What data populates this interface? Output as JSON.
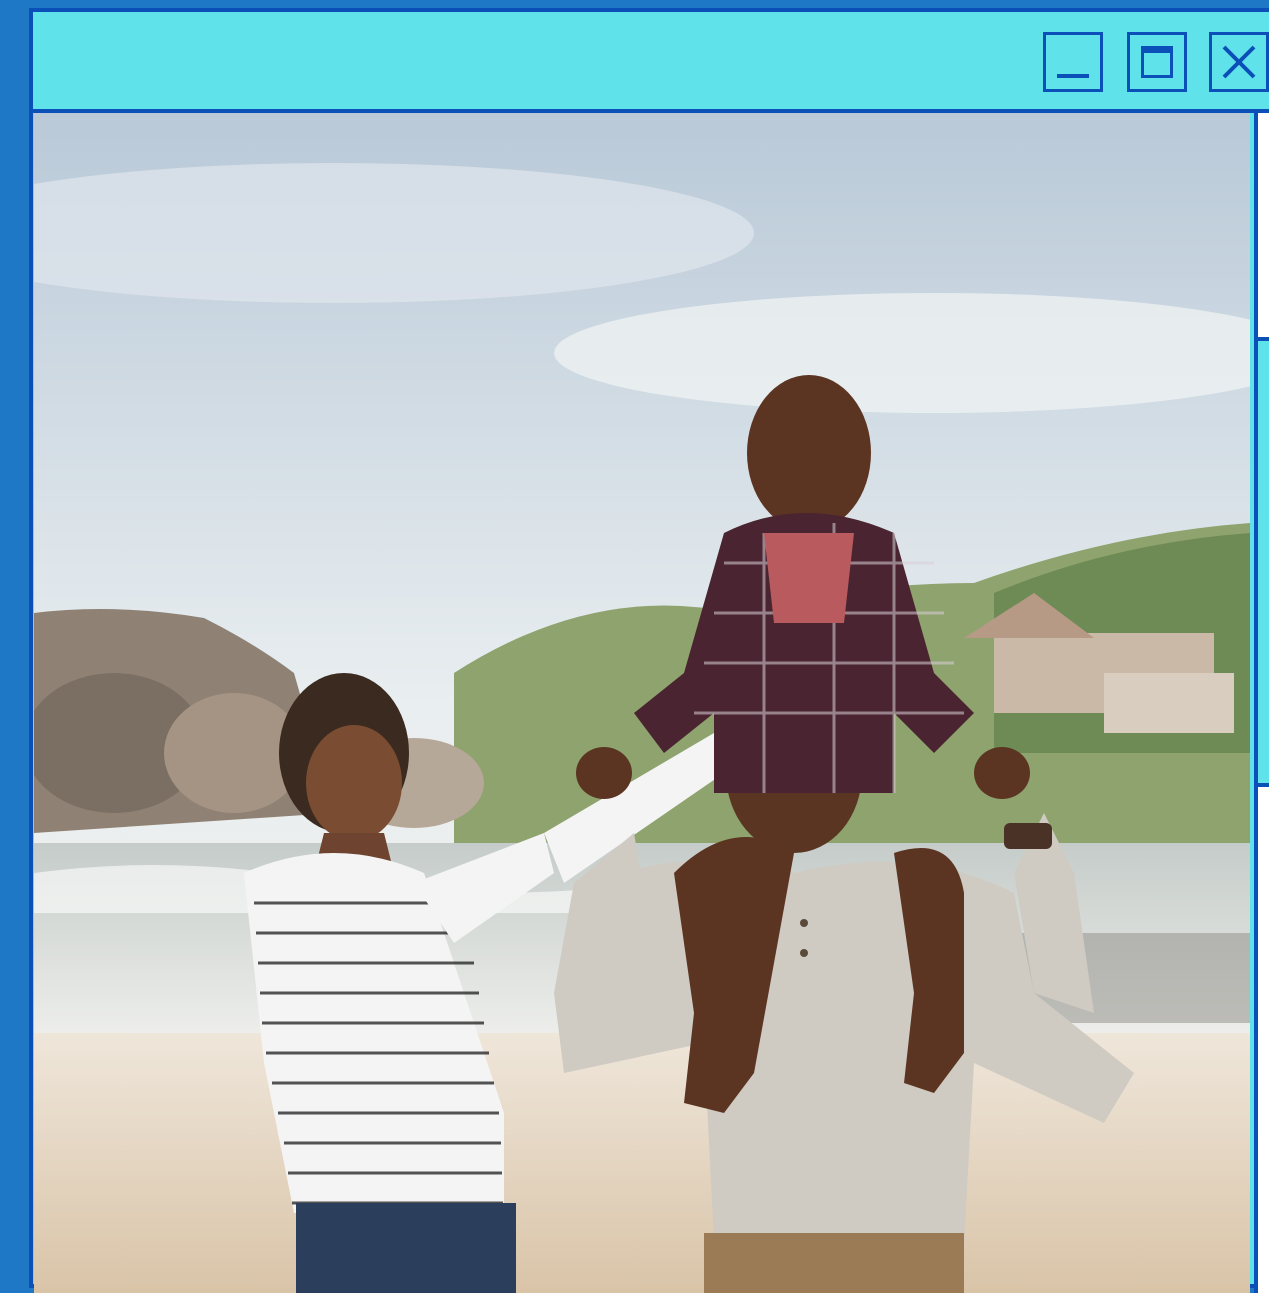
{
  "window": {
    "title": "",
    "controls": {
      "minimize": "minimize-icon",
      "maximize": "maximize-icon",
      "close": "close-icon"
    }
  },
  "colors": {
    "desktop": "#1f78c6",
    "titlebar": "#5fe2e9",
    "border": "#0b4fb8",
    "panel": "#ffffff"
  },
  "photo": {
    "subject": "family-beach-photo"
  }
}
